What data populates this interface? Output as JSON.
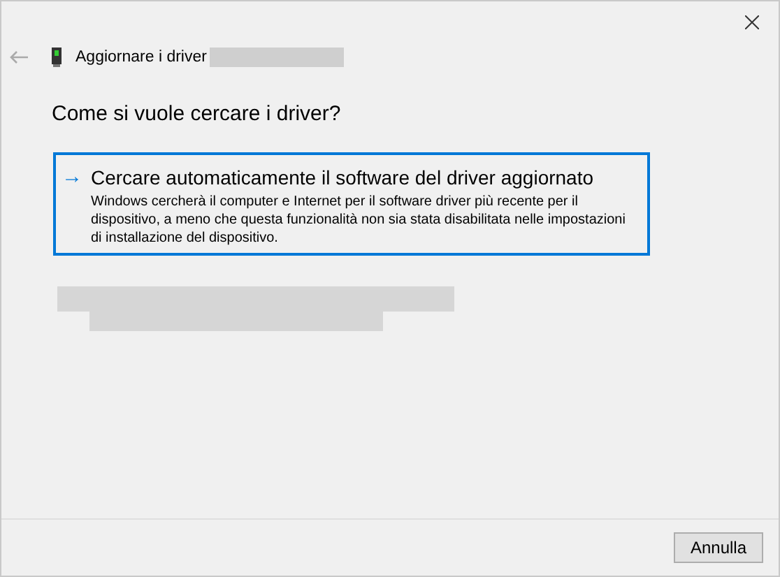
{
  "window": {
    "title": "Aggiornare i driver"
  },
  "heading": "Come si vuole cercare i driver?",
  "options": [
    {
      "kind": "choice",
      "arrow": "→",
      "title": "Cercare automaticamente il software del driver aggiornato",
      "description": "Windows cercherà il computer e Internet per il software driver più recente per il dispositivo, a meno che questa funzionalità non sia stata disabilitata nelle impostazioni di installazione del dispositivo.",
      "selected": true
    },
    {
      "kind": "redacted"
    }
  ],
  "buttons": [
    "Annulla"
  ]
}
